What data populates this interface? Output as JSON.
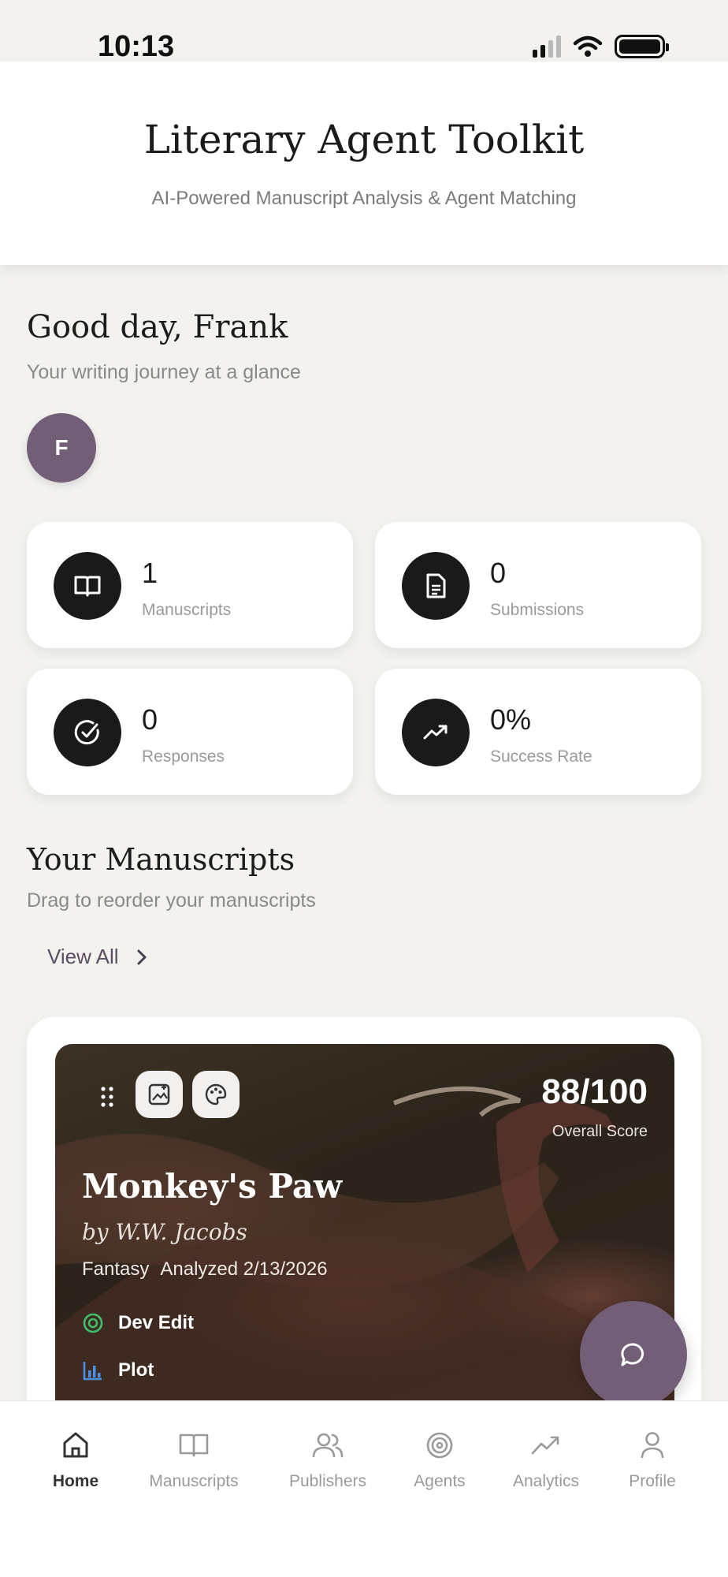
{
  "status_bar": {
    "time": "10:13"
  },
  "header": {
    "title": "Literary Agent Toolkit",
    "subtitle": "AI-Powered Manuscript Analysis & Agent Matching"
  },
  "greeting": {
    "title": "Good day, Frank",
    "subtitle": "Your writing journey at a glance",
    "avatar_initial": "F"
  },
  "stats": [
    {
      "value": "1",
      "label": "Manuscripts",
      "icon": "book-open-icon"
    },
    {
      "value": "0",
      "label": "Submissions",
      "icon": "document-icon"
    },
    {
      "value": "0",
      "label": "Responses",
      "icon": "check-circle-icon"
    },
    {
      "value": "0%",
      "label": "Success Rate",
      "icon": "trending-up-icon"
    }
  ],
  "manuscripts_section": {
    "title": "Your Manuscripts",
    "subtitle": "Drag to reorder your manuscripts",
    "view_all_label": "View All"
  },
  "manuscript": {
    "score": "88/100",
    "score_label": "Overall Score",
    "title": "Monkey's Paw",
    "author": "by W.W. Jacobs",
    "genre": "Fantasy",
    "analyzed": "Analyzed 2/13/2026",
    "tags": [
      {
        "label": "Dev Edit",
        "icon": "target-icon",
        "color": "#3fbf6b"
      },
      {
        "label": "Plot",
        "icon": "bar-chart-icon",
        "color": "#4a8fe0"
      }
    ]
  },
  "bottom_nav": {
    "items": [
      {
        "label": "Home",
        "icon": "home-icon",
        "active": true
      },
      {
        "label": "Manuscripts",
        "icon": "book-open-icon",
        "active": false
      },
      {
        "label": "Publishers",
        "icon": "users-icon",
        "active": false
      },
      {
        "label": "Agents",
        "icon": "target-icon",
        "active": false
      },
      {
        "label": "Analytics",
        "icon": "trending-up-icon",
        "active": false
      },
      {
        "label": "Profile",
        "icon": "user-icon",
        "active": false
      }
    ]
  },
  "colors": {
    "accent": "#735e78",
    "background": "#f3f2ef",
    "card": "#ffffff",
    "stat_icon_bg": "#1a1a1a"
  }
}
